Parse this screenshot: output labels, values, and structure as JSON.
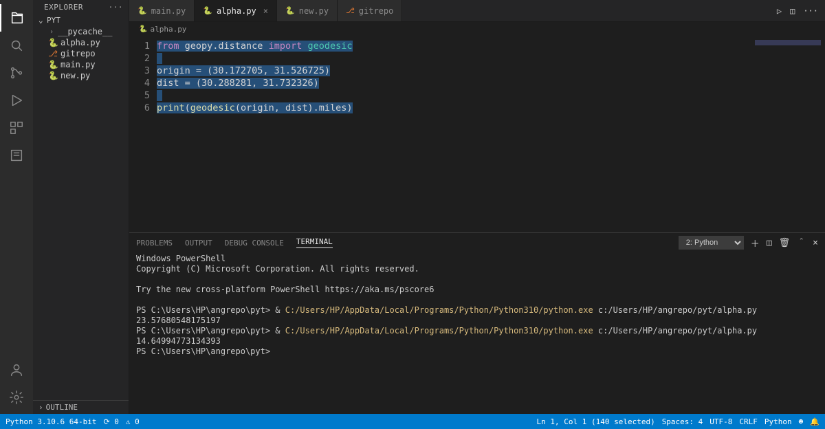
{
  "sidebar": {
    "title": "EXPLORER",
    "root": "PYT",
    "items": [
      {
        "label": "__pycache__",
        "type": "folder",
        "chev": "›"
      },
      {
        "label": "alpha.py",
        "type": "py"
      },
      {
        "label": "gitrepo",
        "type": "git"
      },
      {
        "label": "main.py",
        "type": "py"
      },
      {
        "label": "new.py",
        "type": "py"
      }
    ],
    "outline": "OUTLINE"
  },
  "tabs": [
    {
      "label": "main.py",
      "type": "py",
      "active": false
    },
    {
      "label": "alpha.py",
      "type": "py",
      "active": true
    },
    {
      "label": "new.py",
      "type": "py",
      "active": false
    },
    {
      "label": "gitrepo",
      "type": "git",
      "active": false
    }
  ],
  "breadcrumb": {
    "file": "alpha.py"
  },
  "editor": {
    "lines": [
      "1",
      "2",
      "3",
      "4",
      "5",
      "6"
    ],
    "code": {
      "l1_a": "from",
      "l1_b": " geopy.distance ",
      "l1_c": "import",
      "l1_d": " geodesic",
      "l3": "origin = (30.172705, 31.526725)",
      "l4": "dist = (30.288281, 31.732326)",
      "l6_a": "print",
      "l6_b": "(",
      "l6_c": "geodesic",
      "l6_d": "(origin, dist).miles)"
    }
  },
  "panel": {
    "tabs": [
      "PROBLEMS",
      "OUTPUT",
      "DEBUG CONSOLE",
      "TERMINAL"
    ],
    "activeTab": "TERMINAL",
    "selector": "2: Python",
    "lines": [
      {
        "t": "Windows PowerShell"
      },
      {
        "t": "Copyright (C) Microsoft Corporation. All rights reserved."
      },
      {
        "t": ""
      },
      {
        "t": "Try the new cross-platform PowerShell https://aka.ms/pscore6"
      },
      {
        "t": ""
      },
      {
        "prompt": "PS C:\\Users\\HP\\angrepo\\pyt> ",
        "amp": "& ",
        "exe": "C:/Users/HP/AppData/Local/Programs/Python/Python310/python.exe",
        "arg": " c:/Users/HP/angrepo/pyt/alpha.py"
      },
      {
        "t": "23.57680548175197"
      },
      {
        "prompt": "PS C:\\Users\\HP\\angrepo\\pyt> ",
        "amp": "& ",
        "exe": "C:/Users/HP/AppData/Local/Programs/Python/Python310/python.exe",
        "arg": " c:/Users/HP/angrepo/pyt/alpha.py"
      },
      {
        "t": "14.64994773134393"
      },
      {
        "prompt": "PS C:\\Users\\HP\\angrepo\\pyt> "
      }
    ]
  },
  "status": {
    "left": {
      "python": "Python 3.10.6 64-bit",
      "sync": "⟳ 0",
      "warn": "⚠ 0"
    },
    "right": {
      "lncol": "Ln 1, Col 1 (140 selected)",
      "spaces": "Spaces: 4",
      "enc": "UTF-8",
      "eol": "CRLF",
      "lang": "Python",
      "bell": "🔔"
    }
  }
}
